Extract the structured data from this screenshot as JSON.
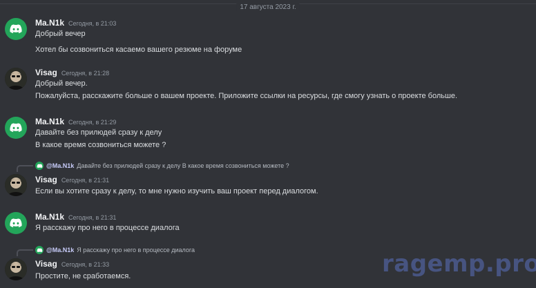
{
  "date_divider": "17 августа 2023 г.",
  "messages": [
    {
      "author": "Ma.N1k",
      "avatar_icon": "discord-logo-icon",
      "timestamp": "Сегодня, в 21:03",
      "lines": [
        "Добрый вечер",
        "Хотел бы созвониться касаемо вашего резюме на форуме"
      ]
    },
    {
      "author": "Visag",
      "avatar_icon": "user-photo",
      "timestamp": "Сегодня, в 21:28",
      "lines": [
        "Добрый вечер.",
        "Пожалуйста, расскажите больше о вашем проекте. Приложите ссылки на ресурсы, где смогу узнать о проекте больше."
      ]
    },
    {
      "author": "Ma.N1k",
      "avatar_icon": "discord-logo-icon",
      "timestamp": "Сегодня, в 21:29",
      "lines": [
        "Давайте без прилюдей сразу к делу",
        "В какое время созвониться можете ?"
      ]
    },
    {
      "author": "Visag",
      "avatar_icon": "user-photo",
      "timestamp": "Сегодня, в 21:31",
      "reply": {
        "mention": "@Ma.N1k",
        "text": "Давайте без прилюдей сразу к делу В какое время созвониться можете ?"
      },
      "lines": [
        "Если вы хотите сразу к делу, то мне нужно изучить ваш проект перед диалогом."
      ]
    },
    {
      "author": "Ma.N1k",
      "avatar_icon": "discord-logo-icon",
      "timestamp": "Сегодня, в 21:31",
      "lines": [
        "Я расскажу про него в процессе диалога"
      ]
    },
    {
      "author": "Visag",
      "avatar_icon": "user-photo",
      "timestamp": "Сегодня, в 21:33",
      "reply": {
        "mention": "@Ma.N1k",
        "text": "Я расскажу про него в процессе диалога"
      },
      "lines": [
        "Простите, не сработаемся."
      ]
    }
  ],
  "watermark": "ragemp.pro",
  "colors": {
    "background": "#313338",
    "discord_green": "#23a55a",
    "mention": "#c9cdfb"
  }
}
